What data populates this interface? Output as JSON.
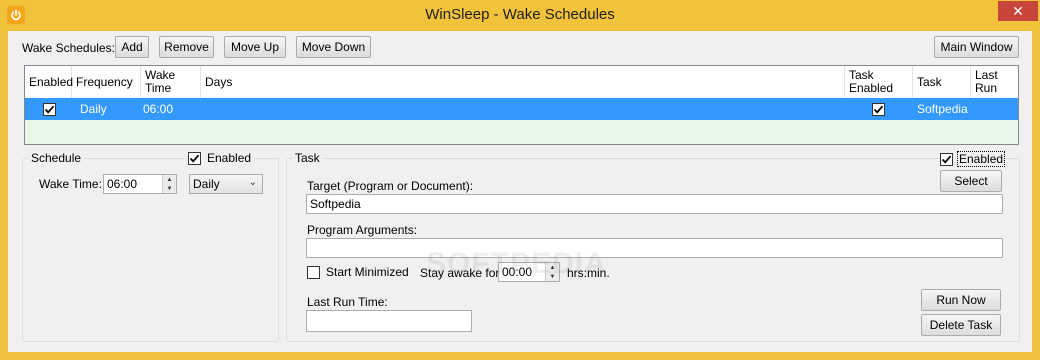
{
  "window": {
    "title": "WinSleep - Wake Schedules",
    "close_glyph": "✕"
  },
  "toolbar": {
    "label": "Wake Schedules:",
    "add": "Add",
    "remove": "Remove",
    "move_up": "Move Up",
    "move_down": "Move Down",
    "main_window": "Main Window"
  },
  "grid": {
    "columns": [
      "Enabled",
      "Frequency",
      "Wake Time",
      "Days",
      "Task Enabled",
      "Task",
      "Last Run"
    ],
    "rows": [
      {
        "enabled": true,
        "frequency": "Daily",
        "wake_time": "06:00",
        "days": "",
        "task_enabled": true,
        "task": "Softpedia",
        "last_run": ""
      }
    ],
    "selected_color": "#3399ff",
    "empty_color": "#e9f8e9"
  },
  "schedule": {
    "group_label": "Schedule",
    "enabled_label": "Enabled",
    "enabled": true,
    "wake_time_label": "Wake Time:",
    "wake_time_value": "06:00",
    "frequency_value": "Daily"
  },
  "task": {
    "group_label": "Task",
    "enabled_label": "Enabled",
    "enabled": true,
    "select_button": "Select",
    "target_label": "Target (Program or Document):",
    "target_value": "Softpedia",
    "arguments_label": "Program Arguments:",
    "arguments_value": "",
    "start_minimized_label": "Start Minimized",
    "start_minimized": false,
    "stay_awake_label": "Stay awake for:",
    "stay_awake_value": "00:00",
    "stay_awake_unit": "hrs:min.",
    "last_run_label": "Last Run Time:",
    "last_run_value": "",
    "run_now_button": "Run Now",
    "delete_task_button": "Delete Task"
  },
  "watermark": "SOFTPEDIA",
  "colors": {
    "titlebar": "#f2c33a",
    "close": "#c7453b",
    "client": "#f0f0f0",
    "selection": "#3399ff"
  }
}
